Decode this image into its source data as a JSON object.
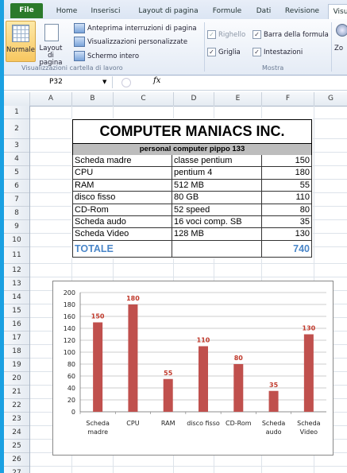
{
  "ribbon": {
    "tabs": [
      "File",
      "Home",
      "Inserisci",
      "Layout di pagina",
      "Formule",
      "Dati",
      "Revisione",
      "Visu"
    ],
    "views": {
      "normale": "Normale",
      "layout_pagina_1": "Layout di",
      "layout_pagina_2": "pagina",
      "anteprima": "Anteprima interruzioni di pagina",
      "personalizzate": "Visualizzazioni personalizzate",
      "schermo_intero": "Schermo intero",
      "group_label": "Visualizzazioni cartella di lavoro"
    },
    "show": {
      "righello": "Righello",
      "barra_formula": "Barra della formula",
      "griglia": "Griglia",
      "intestazioni": "Intestazioni",
      "group_label": "Mostra"
    },
    "zoom_label": "Zo"
  },
  "formula_bar": {
    "name_box": "P32",
    "fx": "fx",
    "formula": ""
  },
  "columns": [
    "A",
    "B",
    "C",
    "D",
    "E",
    "F",
    "G"
  ],
  "rows": [
    "1",
    "2",
    "3",
    "4",
    "5",
    "6",
    "7",
    "8",
    "9",
    "10",
    "11",
    "12",
    "13",
    "14",
    "15",
    "16",
    "17",
    "18",
    "19",
    "20",
    "21",
    "22",
    "23",
    "24",
    "25",
    "26",
    "27",
    "28"
  ],
  "sheet": {
    "title": "COMPUTER MANIACS INC.",
    "subtitle": "personal computer pippo 133",
    "items": [
      {
        "component": "Scheda madre",
        "desc": "classe pentium",
        "value": "150"
      },
      {
        "component": "CPU",
        "desc": "pentium 4",
        "value": "180"
      },
      {
        "component": "RAM",
        "desc": "512 MB",
        "value": "55"
      },
      {
        "component": "disco fisso",
        "desc": "80 GB",
        "value": "110"
      },
      {
        "component": "CD-Rom",
        "desc": "52 speed",
        "value": "80"
      },
      {
        "component": "Scheda audo",
        "desc": "16 voci comp. SB",
        "value": "35"
      },
      {
        "component": "Scheda Video",
        "desc": "128 MB",
        "value": "130"
      }
    ],
    "total_label": "TOTALE",
    "total_value": "740"
  },
  "chart_data": {
    "type": "bar",
    "categories": [
      "Scheda madre",
      "CPU",
      "RAM",
      "disco fisso",
      "CD-Rom",
      "Scheda audo",
      "Scheda Video"
    ],
    "category_lines": [
      [
        "Scheda",
        "madre"
      ],
      [
        "CPU"
      ],
      [
        "RAM"
      ],
      [
        "disco fisso"
      ],
      [
        "CD-Rom"
      ],
      [
        "Scheda",
        "audo"
      ],
      [
        "Scheda",
        "Video"
      ]
    ],
    "values": [
      150,
      180,
      55,
      110,
      80,
      35,
      130
    ],
    "ylim": [
      0,
      200
    ],
    "yticks": [
      0,
      20,
      40,
      60,
      80,
      100,
      120,
      140,
      160,
      180,
      200
    ],
    "title": "",
    "xlabel": "",
    "ylabel": "",
    "bar_color": "#c0504d",
    "label_color": "#c0392b",
    "grid": true,
    "legend": false
  }
}
